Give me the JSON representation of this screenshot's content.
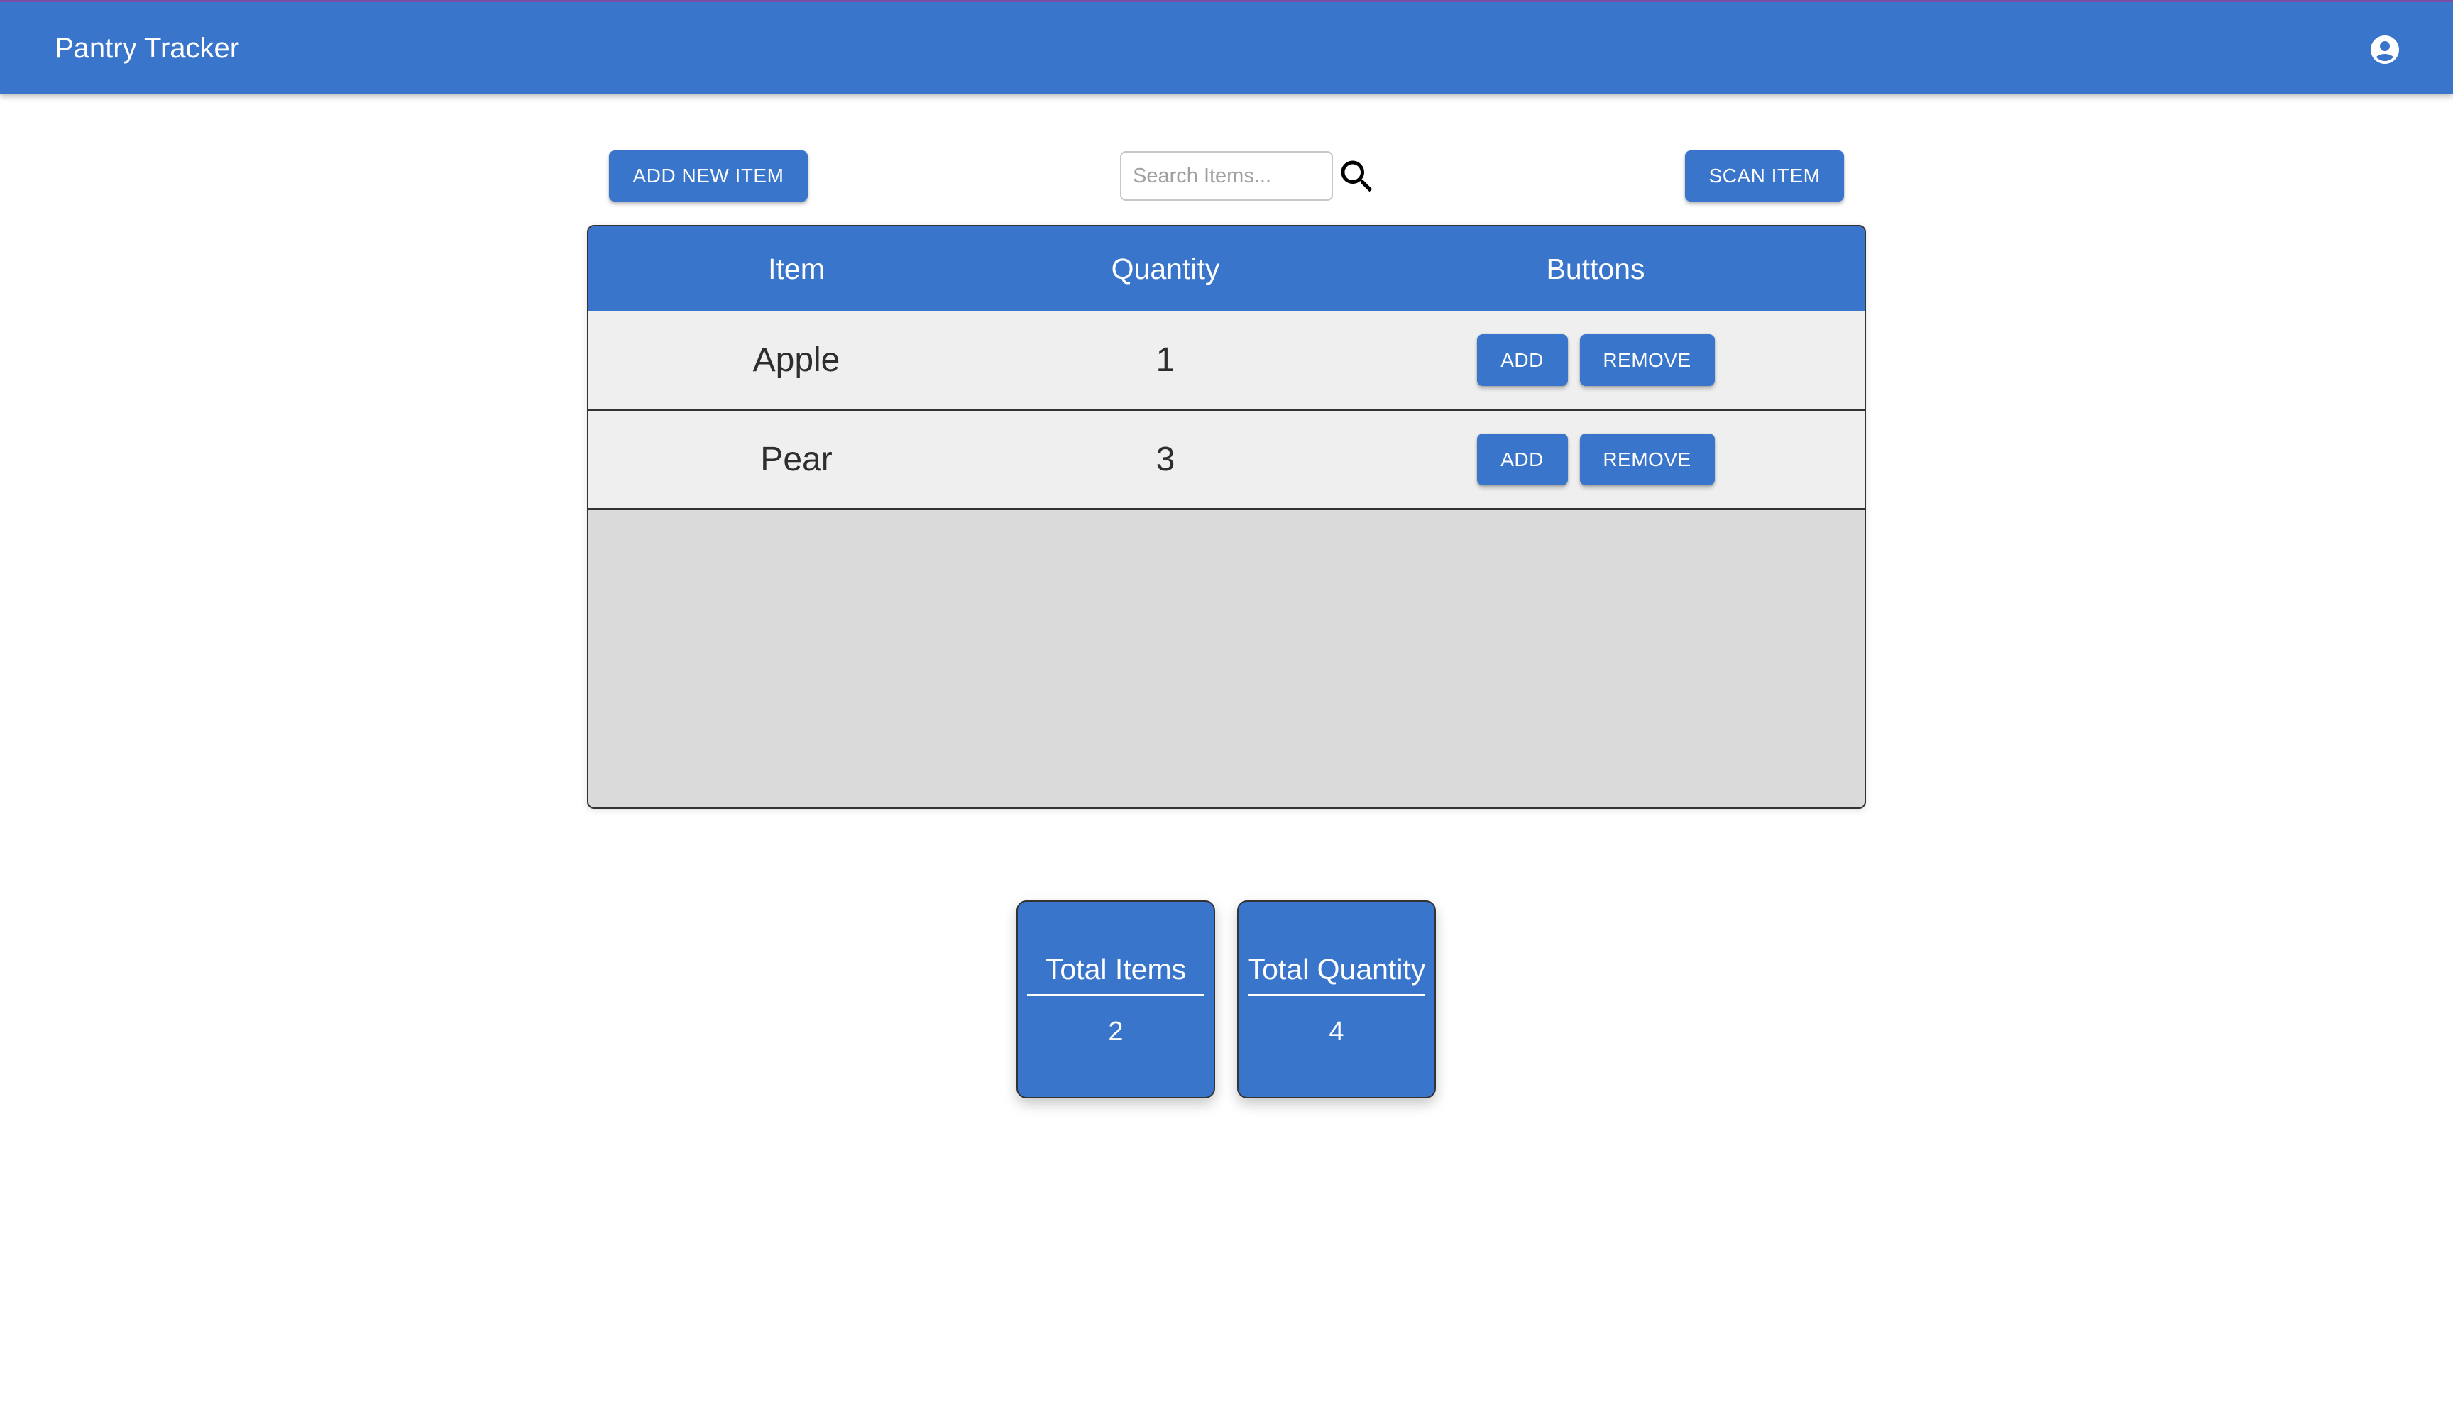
{
  "appbar": {
    "title": "Pantry Tracker",
    "account_icon": "account-circle-icon"
  },
  "colors": {
    "primary": "#3a75cc",
    "accent_strip": "#7b4fa6",
    "row_background": "#efefef",
    "empty_area": "#dadada",
    "border": "#333333"
  },
  "toolbar": {
    "add_new_label": "ADD NEW ITEM",
    "search_placeholder": "Search Items...",
    "search_value": "",
    "search_icon": "search-icon",
    "scan_label": "SCAN ITEM"
  },
  "table": {
    "columns": [
      "Item",
      "Quantity",
      "Buttons"
    ],
    "rows": [
      {
        "item": "Apple",
        "quantity": "1",
        "add_label": "ADD",
        "remove_label": "REMOVE"
      },
      {
        "item": "Pear",
        "quantity": "3",
        "add_label": "ADD",
        "remove_label": "REMOVE"
      }
    ]
  },
  "summary": {
    "total_items": {
      "label": "Total Items",
      "value": "2"
    },
    "total_quantity": {
      "label": "Total Quantity",
      "value": "4"
    }
  }
}
